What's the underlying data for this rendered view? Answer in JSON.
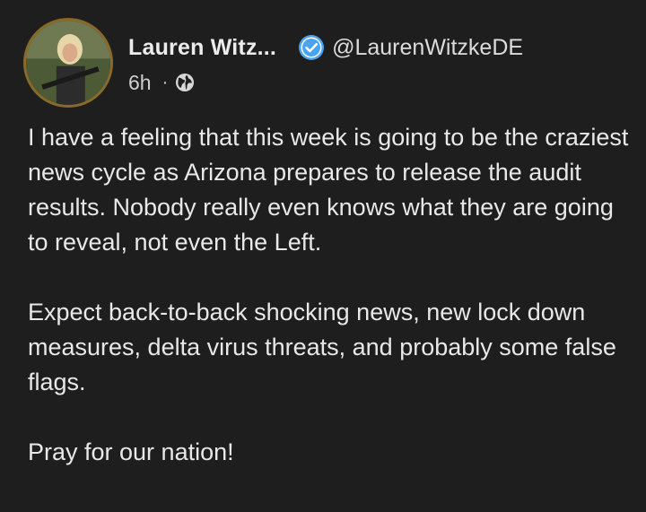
{
  "post": {
    "author_name": "Lauren Witz...",
    "handle": "@LaurenWitzkeDE",
    "timestamp": "6h",
    "separator": "·",
    "verified_icon": "verified-check-icon",
    "visibility_icon": "globe-icon",
    "paragraphs": [
      "I have a feeling that this week is going to be the craziest news cycle as Arizona prepares to release the audit results. Nobody really even knows what they are going to reveal, not even the Left.",
      "Expect back-to-back shocking news, new lock down measures, delta virus threats, and probably some false flags.",
      "Pray for our nation!"
    ]
  },
  "colors": {
    "background": "#1e1e1e",
    "verified_blue": "#4aa3f0",
    "avatar_ring": "#8a6a2a"
  }
}
